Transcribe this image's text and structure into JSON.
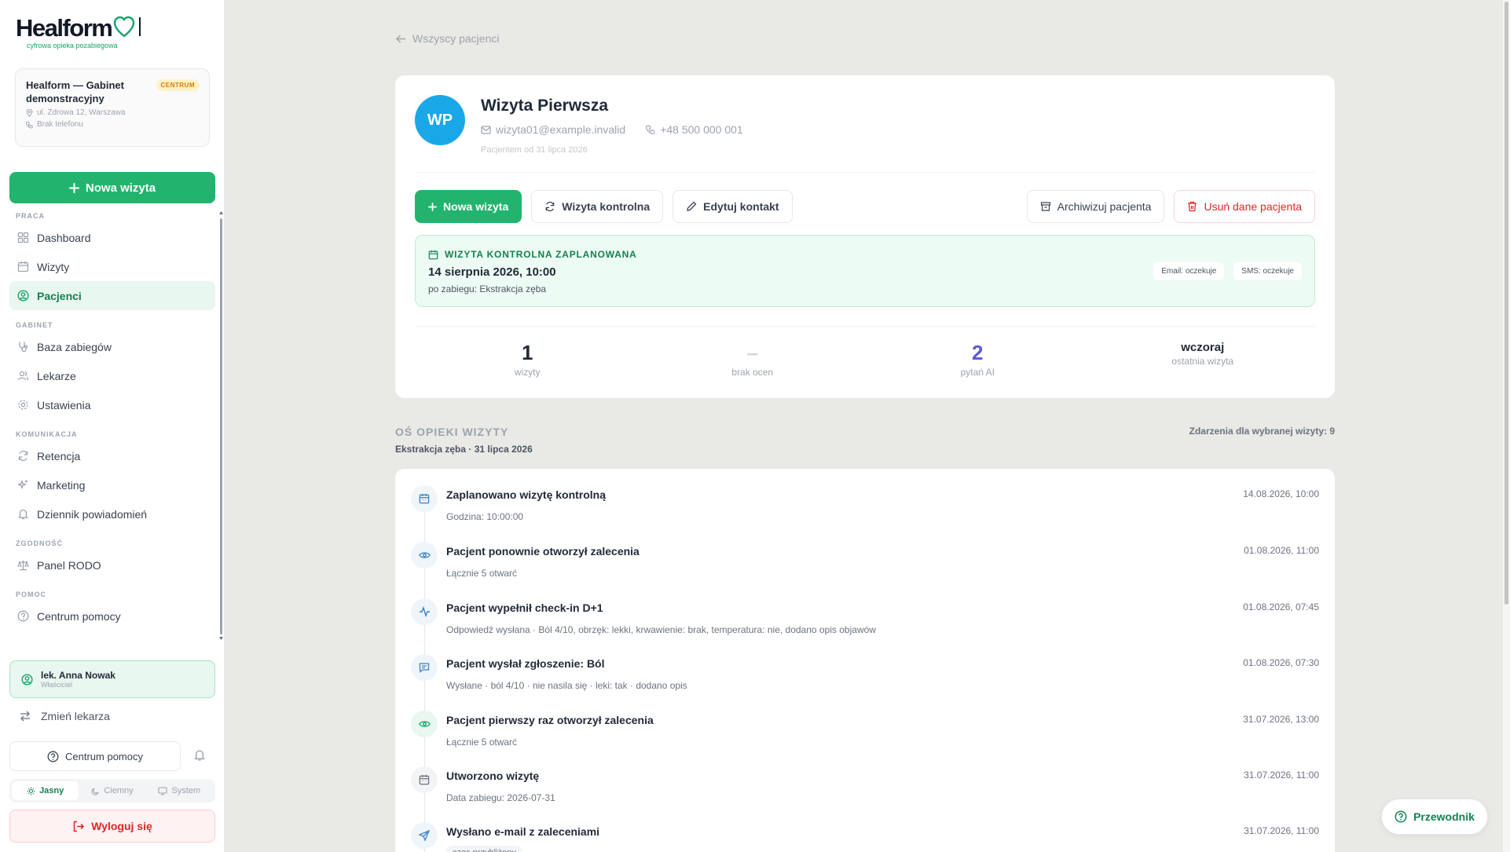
{
  "brand": {
    "logo_main": "Healform",
    "tagline": "cyfrowa opieka pozabiegowa"
  },
  "clinic": {
    "name": "Healform — Gabinet demonstracyjny",
    "badge": "CENTRUM",
    "address": "ul. Zdrowa 12, Warszawa",
    "phone": "Brak telefonu"
  },
  "sidebar": {
    "new_visit": "Nowa wizyta",
    "sections": [
      {
        "title": "PRACA",
        "items": [
          {
            "label": "Dashboard",
            "icon": "grid-icon"
          },
          {
            "label": "Wizyty",
            "icon": "calendar-icon"
          },
          {
            "label": "Pacjenci",
            "icon": "user-circle-icon",
            "active": true
          }
        ]
      },
      {
        "title": "GABINET",
        "items": [
          {
            "label": "Baza zabiegów",
            "icon": "stethoscope-icon"
          },
          {
            "label": "Lekarze",
            "icon": "users-icon"
          },
          {
            "label": "Ustawienia",
            "icon": "gear-icon"
          }
        ]
      },
      {
        "title": "KOMUNIKACJA",
        "items": [
          {
            "label": "Retencja",
            "icon": "refresh-icon"
          },
          {
            "label": "Marketing",
            "icon": "sparkle-icon"
          },
          {
            "label": "Dziennik powiadomień",
            "icon": "bell-icon"
          }
        ]
      },
      {
        "title": "ZGODNOŚĆ",
        "items": [
          {
            "label": "Panel RODO",
            "icon": "scale-icon"
          }
        ]
      },
      {
        "title": "POMOC",
        "items": [
          {
            "label": "Centrum pomocy",
            "icon": "help-icon"
          }
        ]
      }
    ],
    "user_name": "lek. Anna Nowak",
    "user_role": "Właściciel",
    "switch_doctor": "Zmień lekarza",
    "help_center": "Centrum pomocy",
    "themes": [
      "Jasny",
      "Ciemny",
      "System"
    ],
    "active_theme": "Jasny",
    "logout": "Wyloguj się"
  },
  "main": {
    "back_link": "Wszyscy pacjenci",
    "patient": {
      "initials": "WP",
      "name": "Wizyta Pierwsza",
      "email": "wizyta01@example.invalid",
      "phone": "+48 500 000 001",
      "since": "Pacjentem od 31 lipca 2026"
    },
    "actions": {
      "new_visit": "Nowa wizyta",
      "control_visit": "Wizyta kontrolna",
      "edit_contact": "Edytuj kontakt",
      "archive": "Archiwizuj pacjenta",
      "delete": "Usuń dane pacjenta"
    },
    "followup": {
      "label": "WIZYTA KONTROLNA ZAPLANOWANA",
      "date": "14 sierpnia 2026, 10:00",
      "subtitle": "po zabiegu: Ekstrakcja zęba",
      "email_status": "Email: oczekuje",
      "sms_status": "SMS: oczekuje"
    },
    "stats": [
      {
        "value": "1",
        "label": "wizyty",
        "style": ""
      },
      {
        "value": "–",
        "label": "brak ocen",
        "style": "dim"
      },
      {
        "value": "2",
        "label": "pytań AI",
        "style": "purple"
      },
      {
        "value": "wczoraj",
        "label": "ostatnia wizyta",
        "style": "small"
      }
    ],
    "timeline": {
      "heading": "OŚ OPIEKI WIZYTY",
      "subheading": "Ekstrakcja zęba · 31 lipca 2026",
      "count": "Zdarzenia dla wybranej wizyty: 9",
      "events": [
        {
          "title": "Zaplanowano wizytę kontrolną",
          "desc": "Godzina: 10:00:00",
          "time": "14.08.2026, 10:00",
          "icon": "calendar-icon",
          "tone": "blue"
        },
        {
          "title": "Pacjent ponownie otworzył zalecenia",
          "desc": "Łącznie 5 otwarć",
          "time": "01.08.2026, 11:00",
          "icon": "eye-icon",
          "tone": "blue"
        },
        {
          "title": "Pacjent wypełnił check-in D+1",
          "desc": "Odpowiedź wysłana · Ból 4/10, obrzęk: lekki, krwawienie: brak, temperatura: nie, dodano opis objawów",
          "time": "01.08.2026, 07:45",
          "icon": "activity-icon",
          "tone": "blue"
        },
        {
          "title": "Pacjent wysłał zgłoszenie: Ból",
          "desc": "Wysłane · ból 4/10 · nie nasila się · leki: tak · dodano opis",
          "time": "01.08.2026, 07:30",
          "icon": "message-icon",
          "tone": "blue"
        },
        {
          "title": "Pacjent pierwszy raz otworzył zalecenia",
          "desc": "Łącznie 5 otwarć",
          "time": "31.07.2026, 13:00",
          "icon": "eye-icon",
          "tone": "green"
        },
        {
          "title": "Utworzono wizytę",
          "desc": "Data zabiegu: 2026-07-31",
          "time": "31.07.2026, 11:00",
          "icon": "calendar-icon",
          "tone": "gray"
        },
        {
          "title": "Wysłano e-mail z zaleceniami",
          "desc": "czas przybliżony",
          "time": "31.07.2026, 11:00",
          "icon": "send-icon",
          "tone": "blue",
          "chip": true
        }
      ]
    },
    "guide": "Przewodnik"
  },
  "colors": {
    "accent": "#22b46e",
    "danger": "#dc2626",
    "avatar": "#1aa7e8",
    "ai_stat": "#5b5bd6"
  }
}
